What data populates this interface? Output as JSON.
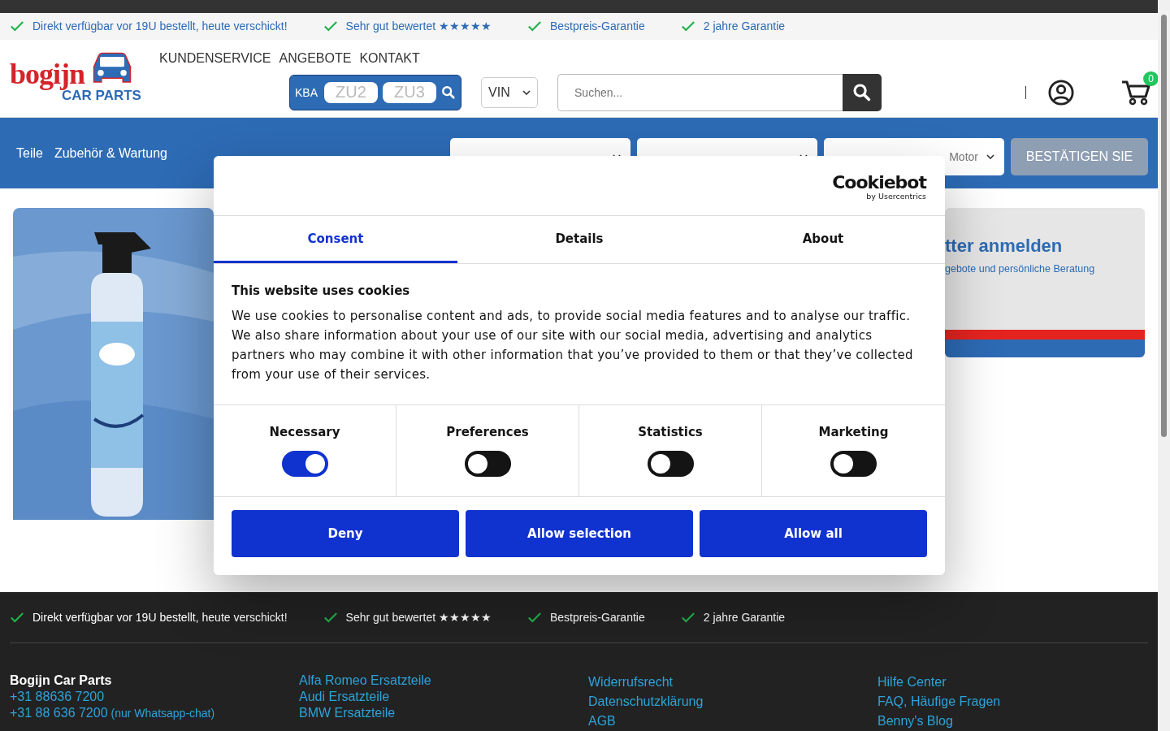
{
  "usp_bar": [
    "Direkt verfügbar vor 19U bestellt, heute verschickt!",
    "Sehr gut bewertet ★★★★★",
    "Bestpreis-Garantie",
    "2 jahre Garantie"
  ],
  "header": {
    "logo": {
      "name": "bogijn",
      "sub": "CAR PARTS"
    },
    "nav": [
      "KUNDENSERVICE",
      "ANGEBOTE",
      "KONTAKT"
    ],
    "kba": {
      "label": "KBA",
      "fields": [
        {
          "placeholder": "ZU2"
        },
        {
          "placeholder": "ZU3"
        }
      ]
    },
    "vin_select": "VIN",
    "search": {
      "placeholder": "Suchen..."
    },
    "cart": {
      "count": "0"
    }
  },
  "category_bar": {
    "links": [
      "Teile",
      "Zubehör & Wartung"
    ],
    "selects": [
      {
        "kind": "dropdown"
      },
      {
        "kind": "dropdown"
      },
      {
        "kind": "dropdown",
        "text": "Motor"
      }
    ],
    "button": "BESTÄTIGEN SIE"
  },
  "promo": {
    "banner": {
      "title": "tter anmelden",
      "subtitle": "gebote und persönliche Beratung"
    }
  },
  "cookie_dialog": {
    "brand": "Cookiebot",
    "brand_sub": "by Usercentrics",
    "tabs": [
      {
        "label": "Consent",
        "selected": true
      },
      {
        "label": "Details",
        "selected": false
      },
      {
        "label": "About",
        "selected": false
      }
    ],
    "heading": "This website uses cookies",
    "body": "We use cookies to personalise content and ads, to provide social media features and to analyse our traffic. We also share information about your use of our site with our social media, advertising and analytics partners who may combine it with other information that you’ve provided to them or that they’ve collected from your use of their services.",
    "toggles": [
      {
        "label": "Necessary",
        "on": true
      },
      {
        "label": "Preferences",
        "on": false
      },
      {
        "label": "Statistics",
        "on": false
      },
      {
        "label": "Marketing",
        "on": false
      }
    ],
    "buttons": [
      "Deny",
      "Allow selection",
      "Allow all"
    ]
  },
  "footer": {
    "usp": [
      "Direkt verfügbar vor 19U bestellt, heute verschickt!",
      "Sehr gut bewertet ★★★★★",
      "Bestpreis-Garantie",
      "2 jahre Garantie"
    ],
    "columns": [
      {
        "items": [
          {
            "kind": "heading",
            "text": "Bogijn Car Parts"
          },
          {
            "kind": "link",
            "text": "+31 88636 7200"
          },
          {
            "kind": "link",
            "text": "+31 88 636 7200",
            "note": "(nur Whatsapp-chat)"
          }
        ]
      },
      {
        "items": [
          {
            "kind": "link",
            "text": "Alfa Romeo Ersatzteile"
          },
          {
            "kind": "link",
            "text": "Audi Ersatzteile"
          },
          {
            "kind": "link",
            "text": "BMW Ersatzteile"
          }
        ]
      },
      {
        "items": [
          {
            "kind": "link",
            "text": "Widerrufsrecht"
          },
          {
            "kind": "link",
            "text": "Datenschutzklärung"
          },
          {
            "kind": "link",
            "text": "AGB"
          }
        ]
      },
      {
        "items": [
          {
            "kind": "link",
            "text": "Hilfe Center"
          },
          {
            "kind": "link",
            "text": "FAQ, Häufige Fragen"
          },
          {
            "kind": "link",
            "text": "Benny's Blog"
          }
        ]
      }
    ]
  }
}
